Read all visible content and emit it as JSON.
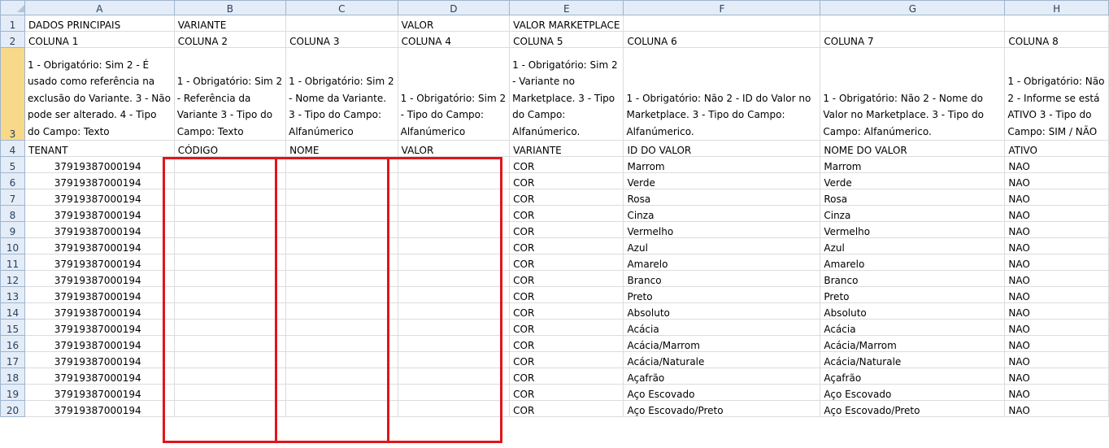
{
  "columns": [
    "A",
    "B",
    "C",
    "D",
    "E",
    "F",
    "G",
    "H"
  ],
  "row_numbers": [
    "1",
    "2",
    "3",
    "4",
    "5",
    "6",
    "7",
    "8",
    "9",
    "10",
    "11",
    "12",
    "13",
    "14",
    "15",
    "16",
    "17",
    "18",
    "19",
    "20"
  ],
  "row1": [
    "DADOS PRINCIPAIS",
    "VARIANTE",
    "",
    "VALOR",
    "VALOR MARKETPLACE",
    "",
    "",
    ""
  ],
  "row2": [
    "COLUNA 1",
    "COLUNA 2",
    "COLUNA 3",
    "COLUNA 4",
    "COLUNA 5",
    "COLUNA 6",
    "COLUNA 7",
    "COLUNA 8"
  ],
  "row3": [
    "1 - Obrigatório: Sim 2 - É usado como referência na exclusão do Variante. 3 - Não pode ser alterado. 4 - Tipo do Campo: Texto",
    "1 - Obrigatório: Sim 2 - Referência da Variante 3 - Tipo do Campo: Texto",
    "1 - Obrigatório: Sim 2 - Nome da Variante. 3 - Tipo do Campo: Alfanúmerico",
    "1 - Obrigatório: Sim 2 - Tipo do Campo: Alfanúmerico",
    "1 - Obrigatório: Sim 2 - Variante no Marketplace. 3 - Tipo do Campo: Alfanúmerico.",
    "1 - Obrigatório: Não 2 - ID do Valor no Marketplace. 3 - Tipo do Campo: Alfanúmerico.",
    "1 - Obrigatório: Não 2 - Nome do Valor no Marketplace. 3 - Tipo do Campo: Alfanúmerico.",
    "1 - Obrigatório: Não 2 - Informe se está ATIVO 3 - Tipo do Campo: SIM / NÃO"
  ],
  "row4": [
    "TENANT",
    "CÓDIGO",
    "NOME",
    "VALOR",
    "VARIANTE",
    "ID DO VALOR",
    "NOME DO VALOR",
    "ATIVO"
  ],
  "data_rows": [
    {
      "tenant": "37919387000194",
      "variante": "COR",
      "id": "Marrom",
      "nome": "Marrom",
      "ativo": "NAO"
    },
    {
      "tenant": "37919387000194",
      "variante": "COR",
      "id": "Verde",
      "nome": "Verde",
      "ativo": "NAO"
    },
    {
      "tenant": "37919387000194",
      "variante": "COR",
      "id": "Rosa",
      "nome": "Rosa",
      "ativo": "NAO"
    },
    {
      "tenant": "37919387000194",
      "variante": "COR",
      "id": "Cinza",
      "nome": "Cinza",
      "ativo": "NAO"
    },
    {
      "tenant": "37919387000194",
      "variante": "COR",
      "id": "Vermelho",
      "nome": "Vermelho",
      "ativo": "NAO"
    },
    {
      "tenant": "37919387000194",
      "variante": "COR",
      "id": "Azul",
      "nome": "Azul",
      "ativo": "NAO"
    },
    {
      "tenant": "37919387000194",
      "variante": "COR",
      "id": "Amarelo",
      "nome": "Amarelo",
      "ativo": "NAO"
    },
    {
      "tenant": "37919387000194",
      "variante": "COR",
      "id": "Branco",
      "nome": "Branco",
      "ativo": "NAO"
    },
    {
      "tenant": "37919387000194",
      "variante": "COR",
      "id": "Preto",
      "nome": "Preto",
      "ativo": "NAO"
    },
    {
      "tenant": "37919387000194",
      "variante": "COR",
      "id": "Absoluto",
      "nome": "Absoluto",
      "ativo": "NAO"
    },
    {
      "tenant": "37919387000194",
      "variante": "COR",
      "id": "Acácia",
      "nome": "Acácia",
      "ativo": "NAO"
    },
    {
      "tenant": "37919387000194",
      "variante": "COR",
      "id": "Acácia/Marrom",
      "nome": "Acácia/Marrom",
      "ativo": "NAO"
    },
    {
      "tenant": "37919387000194",
      "variante": "COR",
      "id": "Acácia/Naturale",
      "nome": "Acácia/Naturale",
      "ativo": "NAO"
    },
    {
      "tenant": "37919387000194",
      "variante": "COR",
      "id": "Açafrão",
      "nome": "Açafrão",
      "ativo": "NAO"
    },
    {
      "tenant": "37919387000194",
      "variante": "COR",
      "id": "Aço Escovado",
      "nome": "Aço Escovado",
      "ativo": "NAO"
    },
    {
      "tenant": "37919387000194",
      "variante": "COR",
      "id": "Aço Escovado/Preto",
      "nome": "Aço Escovado/Preto",
      "ativo": "NAO"
    }
  ],
  "colors": {
    "header_bg": "#e4ecf7",
    "selected_row_header": "#f8d889",
    "highlight_border": "#e2141b",
    "gridline": "#dadcdd"
  }
}
